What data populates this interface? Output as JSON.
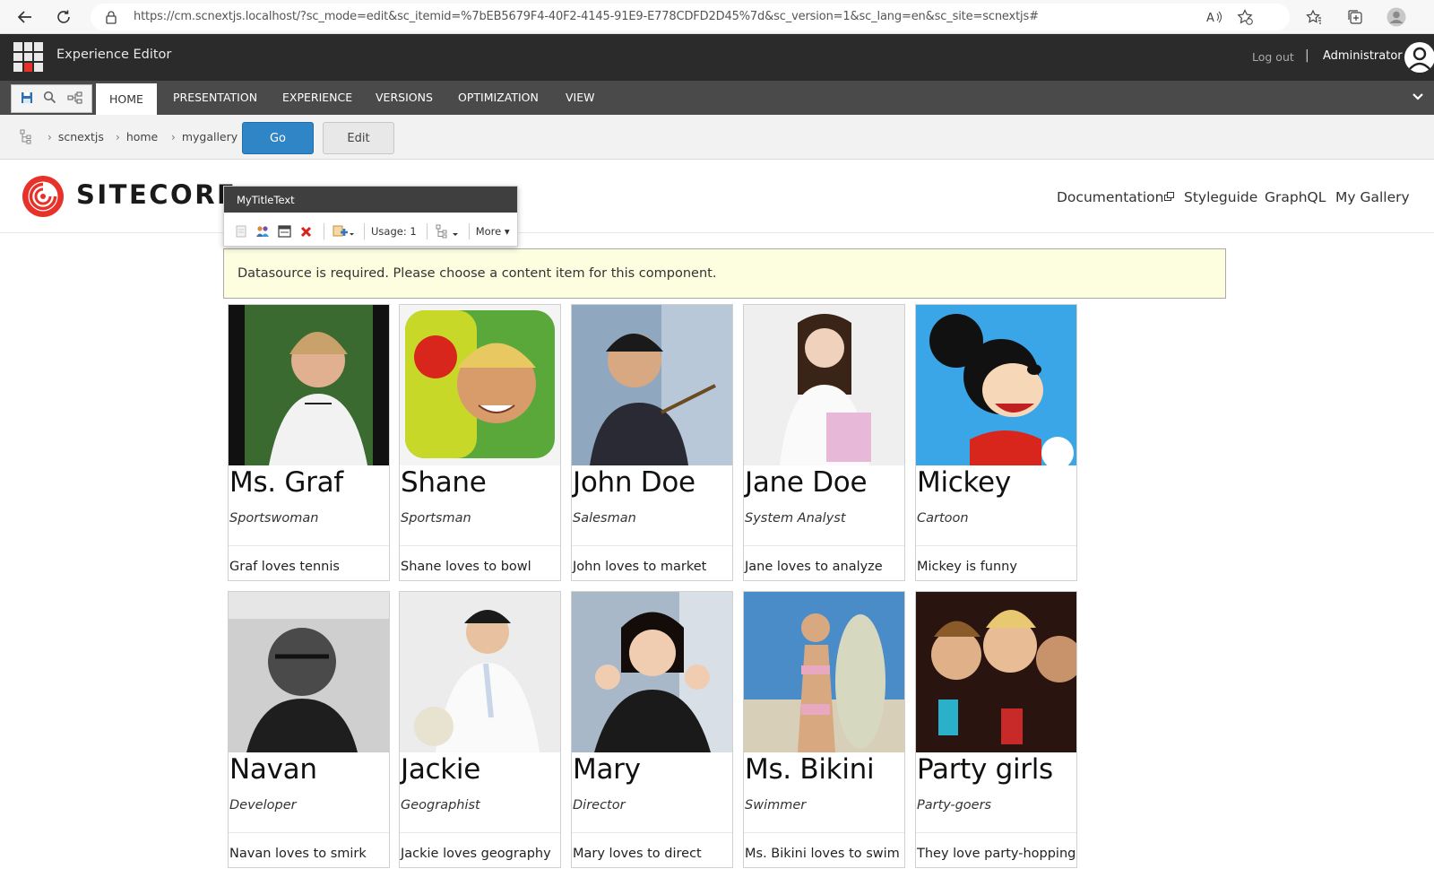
{
  "browser": {
    "url": "https://cm.scnextjs.localhost/?sc_mode=edit&sc_itemid=%7bEB5679F4-40F2-4145-91E9-E778CDFD2D45%7d&sc_version=1&sc_lang=en&sc_site=scnextjs#"
  },
  "editor": {
    "title": "Experience Editor",
    "logout": "Log out",
    "separator": "|",
    "user": "Administrator"
  },
  "ribbon": {
    "tabs": [
      "HOME",
      "PRESENTATION",
      "EXPERIENCE",
      "VERSIONS",
      "OPTIMIZATION",
      "VIEW"
    ],
    "active_tab": "HOME"
  },
  "breadcrumb": {
    "items": [
      "scnextjs",
      "home",
      "mygallery"
    ],
    "go_label": "Go",
    "edit_label": "Edit"
  },
  "site": {
    "logo_text": "SITECORE",
    "nav": [
      "Documentation",
      "Styleguide",
      "GraphQL",
      "My Gallery"
    ]
  },
  "chrome": {
    "title": "MyTitleText",
    "usage": "Usage: 1",
    "more": "More"
  },
  "warning": "Datasource is required. Please choose a content item for this component.",
  "gallery": [
    {
      "name": "Ms. Graf",
      "role": "Sportswoman",
      "desc": "Graf loves tennis"
    },
    {
      "name": "Shane",
      "role": "Sportsman",
      "desc": "Shane loves to bowl"
    },
    {
      "name": "John Doe",
      "role": "Salesman",
      "desc": "John loves to market"
    },
    {
      "name": "Jane Doe",
      "role": "System Analyst",
      "desc": "Jane loves to analyze"
    },
    {
      "name": "Mickey",
      "role": "Cartoon",
      "desc": "Mickey is funny"
    },
    {
      "name": "Navan",
      "role": "Developer",
      "desc": "Navan loves to smirk"
    },
    {
      "name": "Jackie",
      "role": "Geographist",
      "desc": "Jackie loves geography"
    },
    {
      "name": "Mary",
      "role": "Director",
      "desc": "Mary loves to direct"
    },
    {
      "name": "Ms. Bikini",
      "role": "Swimmer",
      "desc": "Ms. Bikini loves to swim"
    },
    {
      "name": "Party girls",
      "role": "Party-goers",
      "desc": "They love party-hopping"
    }
  ],
  "colors": {
    "editor_bg": "#2b2b2b",
    "ribbon_bg": "#4a4a4a",
    "go_button": "#2f85c5",
    "warning_bg": "#fdfde0",
    "brand_red": "#e83129"
  }
}
